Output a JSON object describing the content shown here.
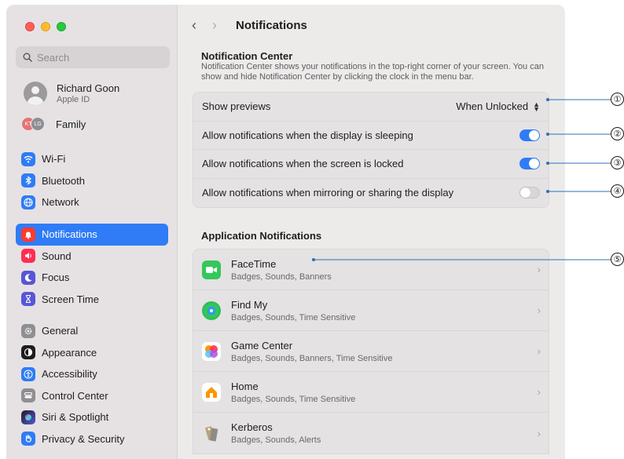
{
  "window": {
    "title": "Notifications"
  },
  "search": {
    "placeholder": "Search"
  },
  "account": {
    "name": "Richard Goon",
    "subtitle": "Apple ID",
    "family_label": "Family",
    "family_initials": [
      "KT",
      "LG"
    ]
  },
  "sidebar": {
    "items": [
      {
        "label": "Wi-Fi",
        "icon": "wifi-icon",
        "color": "#2f7cf6"
      },
      {
        "label": "Bluetooth",
        "icon": "bluetooth-icon",
        "color": "#2f7cf6"
      },
      {
        "label": "Network",
        "icon": "globe-icon",
        "color": "#2f7cf6"
      },
      {
        "label": "Notifications",
        "icon": "bell-icon",
        "color": "#ff3b30",
        "selected": true
      },
      {
        "label": "Sound",
        "icon": "speaker-icon",
        "color": "#ff2d55"
      },
      {
        "label": "Focus",
        "icon": "moon-icon",
        "color": "#5856d6"
      },
      {
        "label": "Screen Time",
        "icon": "hourglass-icon",
        "color": "#5856d6"
      },
      {
        "label": "General",
        "icon": "gear-icon",
        "color": "#8e8e93"
      },
      {
        "label": "Appearance",
        "icon": "appearance-icon",
        "color": "#1d1d1f"
      },
      {
        "label": "Accessibility",
        "icon": "accessibility-icon",
        "color": "#2f7cf6"
      },
      {
        "label": "Control Center",
        "icon": "control-center-icon",
        "color": "#8e8e93"
      },
      {
        "label": "Siri & Spotlight",
        "icon": "siri-icon",
        "color": "#1d1d1f"
      },
      {
        "label": "Privacy & Security",
        "icon": "hand-icon",
        "color": "#2f7cf6"
      }
    ]
  },
  "notification_center": {
    "title": "Notification Center",
    "description": "Notification Center shows your notifications in the top-right corner of your screen. You can show and hide Notification Center by clicking the clock in the menu bar.",
    "settings": [
      {
        "label": "Show previews",
        "type": "popup",
        "value": "When Unlocked"
      },
      {
        "label": "Allow notifications when the display is sleeping",
        "type": "toggle",
        "on": true
      },
      {
        "label": "Allow notifications when the screen is locked",
        "type": "toggle",
        "on": true
      },
      {
        "label": "Allow notifications when mirroring or sharing the display",
        "type": "toggle",
        "on": false
      }
    ]
  },
  "app_notifications": {
    "title": "Application Notifications",
    "apps": [
      {
        "name": "FaceTime",
        "details": "Badges, Sounds, Banners",
        "icon": "facetime-icon"
      },
      {
        "name": "Find My",
        "details": "Badges, Sounds, Time Sensitive",
        "icon": "find-my-icon"
      },
      {
        "name": "Game Center",
        "details": "Badges, Sounds, Banners, Time Sensitive",
        "icon": "game-center-icon"
      },
      {
        "name": "Home",
        "details": "Badges, Sounds, Time Sensitive",
        "icon": "home-icon"
      },
      {
        "name": "Kerberos",
        "details": "Badges, Sounds, Alerts",
        "icon": "kerberos-icon"
      }
    ]
  },
  "callouts": [
    "①",
    "②",
    "③",
    "④",
    "⑤"
  ]
}
